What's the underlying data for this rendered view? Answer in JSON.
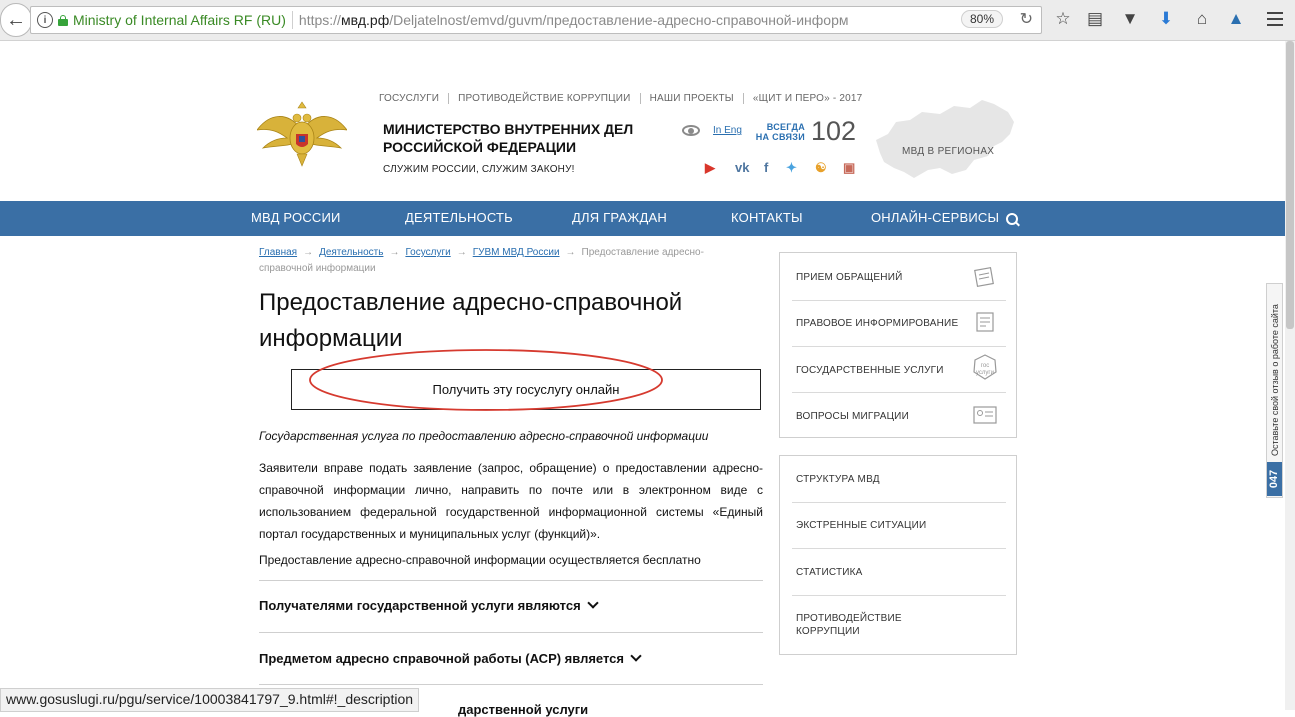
{
  "browser": {
    "site_identity": "Ministry of Internal Affairs RF (RU)",
    "url_prefix": "https://",
    "url_host": "мвд.рф",
    "url_path": "/Deljatelnost/emvd/guvm/предоставление-адресно-справочной-информ",
    "zoom": "80%",
    "status_url": "www.gosuslugi.ru/pgu/service/10003841797_9.html#!_description"
  },
  "header": {
    "top_links": [
      "ГОСУСЛУГИ",
      "ПРОТИВОДЕЙСТВИЕ КОРРУПЦИИ",
      "НАШИ ПРОЕКТЫ",
      "«ЩИТ И ПЕРО» - 2017"
    ],
    "title_line1": "МИНИСТЕРСТВО ВНУТРЕННИХ ДЕЛ",
    "title_line2": "РОССИЙСКОЙ ФЕДЕРАЦИИ",
    "motto": "СЛУЖИМ РОССИИ, СЛУЖИМ ЗАКОНУ!",
    "lang": "In Eng",
    "always_line1": "ВСЕГДА",
    "always_line2": "НА СВЯЗИ",
    "hotline": "102",
    "regions": "МВД В РЕГИОНАХ"
  },
  "nav": [
    "МВД РОССИИ",
    "ДЕЯТЕЛЬНОСТЬ",
    "ДЛЯ ГРАЖДАН",
    "КОНТАКТЫ",
    "ОНЛАЙН-СЕРВИСЫ"
  ],
  "breadcrumb": {
    "home": "Главная",
    "activity": "Деятельность",
    "gosuslugi": "Госуслуги",
    "guvm": "ГУВМ МВД России",
    "current": "Предоставление адресно-справочной информации"
  },
  "content": {
    "title": "Предоставление адресно-справочной информации",
    "button": "Получить эту госуслугу онлайн",
    "italic": "Государственная услуга по предоставлению адресно-справочной информации",
    "paragraph": "Заявители вправе подать заявление (запрос, обращение) о предоставлении адресно-справочной информации лично, направить по почте или в электронном виде с использованием федеральной государственной информационной системы «Единый портал государственных и муниципальных услуг (функций)».",
    "free": "Предоставление адресно-справочной информации осуществляется бесплатно",
    "accordion": [
      "Получателями государственной услуги являются",
      "Предметом адресно справочной работы (АСР) является"
    ],
    "partial": "дарственной услуги"
  },
  "sidebar": {
    "group1": [
      "ПРИЕМ ОБРАЩЕНИЙ",
      "ПРАВОВОЕ ИНФОРМИРОВАНИЕ",
      "ГОСУДАРСТВЕННЫЕ УСЛУГИ",
      "ВОПРОСЫ МИГРАЦИИ"
    ],
    "group2": [
      "СТРУКТУРА МВД",
      "ЭКСТРЕННЫЕ СИТУАЦИИ",
      "СТАТИСТИКА",
      "ПРОТИВОДЕЙСТВИЕ КОРРУПЦИИ"
    ],
    "gos_icon_text": "гос услуги"
  },
  "feedback": {
    "label": "Оставьте свой отзыв о работе сайта",
    "count": "047"
  },
  "colors": {
    "nav": "#3a6fa5",
    "link": "#2a6fb0",
    "annotation": "#d63a2f"
  }
}
